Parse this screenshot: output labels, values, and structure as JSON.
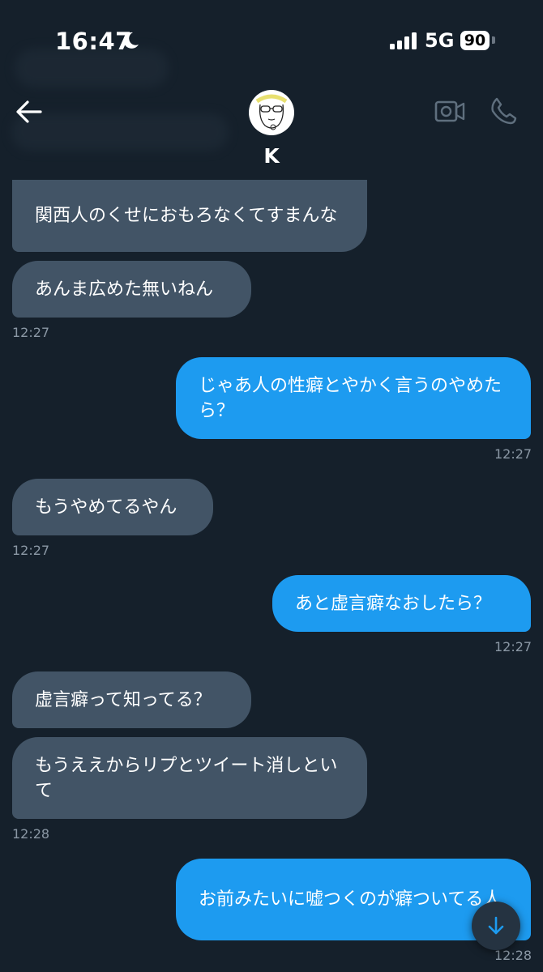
{
  "status_bar": {
    "time": "16:47",
    "network": "5G",
    "battery": "90"
  },
  "header": {
    "contact_name": "K",
    "icons": [
      "back-arrow-icon",
      "video-call-icon",
      "phone-icon"
    ]
  },
  "messages": [
    {
      "side": "incoming",
      "text": "関西人のくせにおもろなくてすまんな"
    },
    {
      "side": "incoming",
      "text": "あんま広めた無いねん",
      "time": "12:27"
    },
    {
      "side": "outgoing",
      "text": "じゃあ人の性癖とやかく言うのやめたら？",
      "time": "12:27"
    },
    {
      "side": "incoming",
      "text": "もうやめてるやん",
      "time": "12:27"
    },
    {
      "side": "outgoing",
      "text": "あと虚言癖なおしたら？",
      "time": "12:27"
    },
    {
      "side": "incoming",
      "text": "虚言癖って知ってる？"
    },
    {
      "side": "incoming",
      "text": "もうええからリプとツイート消しといて",
      "time": "12:28"
    },
    {
      "side": "outgoing",
      "text": "お前みたいに嘘つくのが癖ついてる人",
      "time": "12:28"
    }
  ],
  "colors": {
    "background": "#15202b",
    "incoming_bubble": "#425466",
    "outgoing_bubble": "#1d9bf0",
    "timestamp": "#8b98a5"
  }
}
